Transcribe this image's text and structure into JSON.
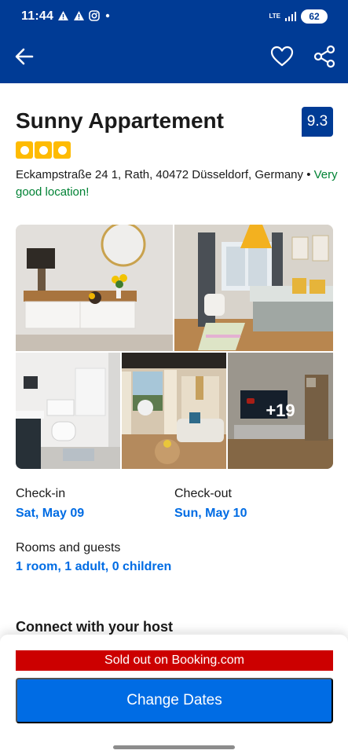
{
  "status_bar": {
    "time": "11:44",
    "network": "LTE",
    "battery": "62"
  },
  "header": {
    "back_icon": "arrow-left-icon",
    "favorite_icon": "heart-icon",
    "share_icon": "share-icon"
  },
  "property": {
    "name": "Sunny Appartement",
    "review_score": "9.3",
    "star_rating": 3,
    "address": "Eckampstraße 24 1, Rath, 40472 Düsseldorf, Germany",
    "separator": "•",
    "location_note": "Very good location!"
  },
  "gallery": {
    "more_photos": "+19"
  },
  "booking": {
    "checkin_label": "Check-in",
    "checkin_value": "Sat, May 09",
    "checkout_label": "Check-out",
    "checkout_value": "Sun, May 10",
    "guests_label": "Rooms and guests",
    "guests_value": "1 room, 1 adult, 0 children"
  },
  "section": {
    "connect_title": "Connect with your host"
  },
  "footer": {
    "sold_out": "Sold out on Booking.com",
    "change_dates": "Change Dates"
  },
  "colors": {
    "brand_blue": "#003b95",
    "action_blue": "#006ce4",
    "star_yellow": "#febb02",
    "location_green": "#008234",
    "sold_out_red": "#cc0000"
  }
}
